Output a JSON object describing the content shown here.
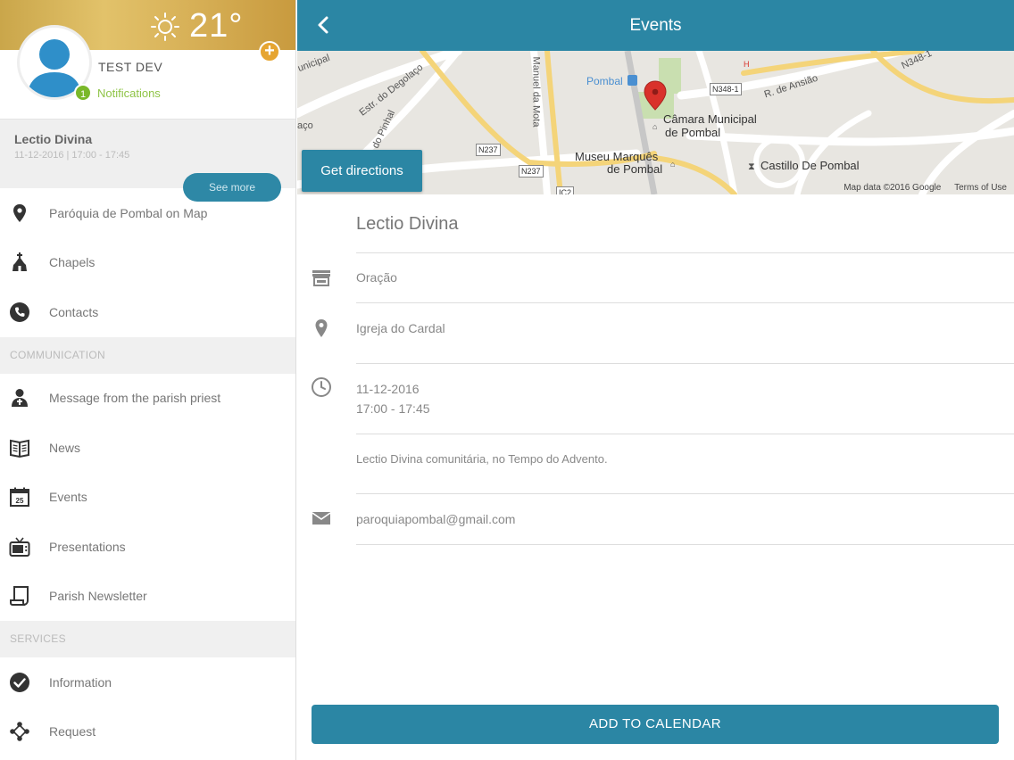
{
  "sidebar": {
    "weather": {
      "temperature": "21°"
    },
    "profile": {
      "name": "TEST DEV",
      "notification_count": "1",
      "notifications_label": "Notifications"
    },
    "event_card": {
      "title": "Lectio Divina",
      "datetime": "11-12-2016 | 17:00 - 17:45",
      "see_more": "See more"
    },
    "items": [
      {
        "label": "Paróquia de Pombal on Map",
        "icon": "map-pin-icon"
      },
      {
        "label": "Chapels",
        "icon": "chapel-icon"
      },
      {
        "label": "Contacts",
        "icon": "phone-icon"
      }
    ],
    "sections": [
      {
        "header": "COMMUNICATION",
        "items": [
          {
            "label": "Message from the parish priest",
            "icon": "priest-icon"
          },
          {
            "label": "News",
            "icon": "newspaper-icon"
          },
          {
            "label": "Events",
            "icon": "calendar-icon"
          },
          {
            "label": "Presentations",
            "icon": "tv-icon"
          },
          {
            "label": "Parish Newsletter",
            "icon": "newsletter-icon"
          }
        ]
      },
      {
        "header": "SERVICES",
        "items": [
          {
            "label": "Information",
            "icon": "check-circle-icon"
          },
          {
            "label": "Request",
            "icon": "share-nodes-icon"
          }
        ]
      }
    ]
  },
  "header": {
    "title": "Events"
  },
  "map": {
    "directions_label": "Get directions",
    "credit": "Map data ©2016 Google",
    "terms": "Terms of Use",
    "labels": {
      "pombal": "Pombal",
      "camara": "Câmara Municipal",
      "camara2": "de Pombal",
      "museu": "Museu Marquês",
      "museu2": "de Pombal",
      "castillo": "Castillo De Pombal",
      "degolaco": "Estr. do Degolaço",
      "pinhal": "do Pinhal",
      "mota": "Manuel da Mota",
      "ansiao": "R. de Ansião",
      "n237a": "N237",
      "n237b": "N237",
      "n348": "N348-1",
      "n348b": "N348-1",
      "ic2": "IC2",
      "h": "H",
      "municipal": "unicipal",
      "aco": "aço"
    }
  },
  "event": {
    "title": "Lectio Divina",
    "category": "Oração",
    "location": "Igreja do Cardal",
    "date": "11-12-2016",
    "time": "17:00 - 17:45",
    "description": "Lectio Divina comunitária, no Tempo do Advento.",
    "email": "paroquiapombal@gmail.com"
  },
  "actions": {
    "add_to_calendar": "ADD TO CALENDAR"
  },
  "colors": {
    "accent": "#2b86a4",
    "notification": "#7ab829",
    "add": "#e6a531",
    "pin": "#d9322b"
  }
}
